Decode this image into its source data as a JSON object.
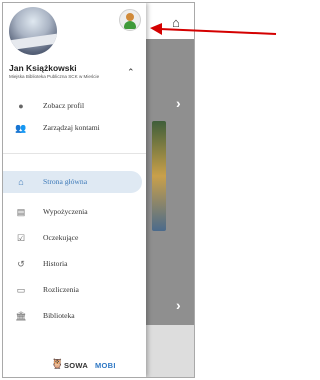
{
  "user": {
    "name": "Jan Książkowski",
    "library": "Miejska Biblioteka Publiczna SCK w Mieście"
  },
  "account_menu": [
    {
      "label": "Zobacz profil",
      "icon": "account-circle-icon"
    },
    {
      "label": "Zarządzaj kontami",
      "icon": "accounts-group-icon"
    }
  ],
  "nav": [
    {
      "label": "Strona główna",
      "icon": "home-icon",
      "active": true
    },
    {
      "label": "Wypożyczenia",
      "icon": "books-icon",
      "active": false
    },
    {
      "label": "Oczekujące",
      "icon": "calendar-check-icon",
      "active": false
    },
    {
      "label": "Historia",
      "icon": "history-icon",
      "active": false
    },
    {
      "label": "Rozliczenia",
      "icon": "credit-card-icon",
      "active": false
    },
    {
      "label": "Biblioteka",
      "icon": "library-building-icon",
      "active": false
    }
  ],
  "logo": {
    "part1": "SOWA",
    "part2": "MOBI"
  },
  "colors": {
    "accent": "#3c79b8",
    "active_bg": "#dfe9f3",
    "annotation_arrow": "#d40000"
  }
}
